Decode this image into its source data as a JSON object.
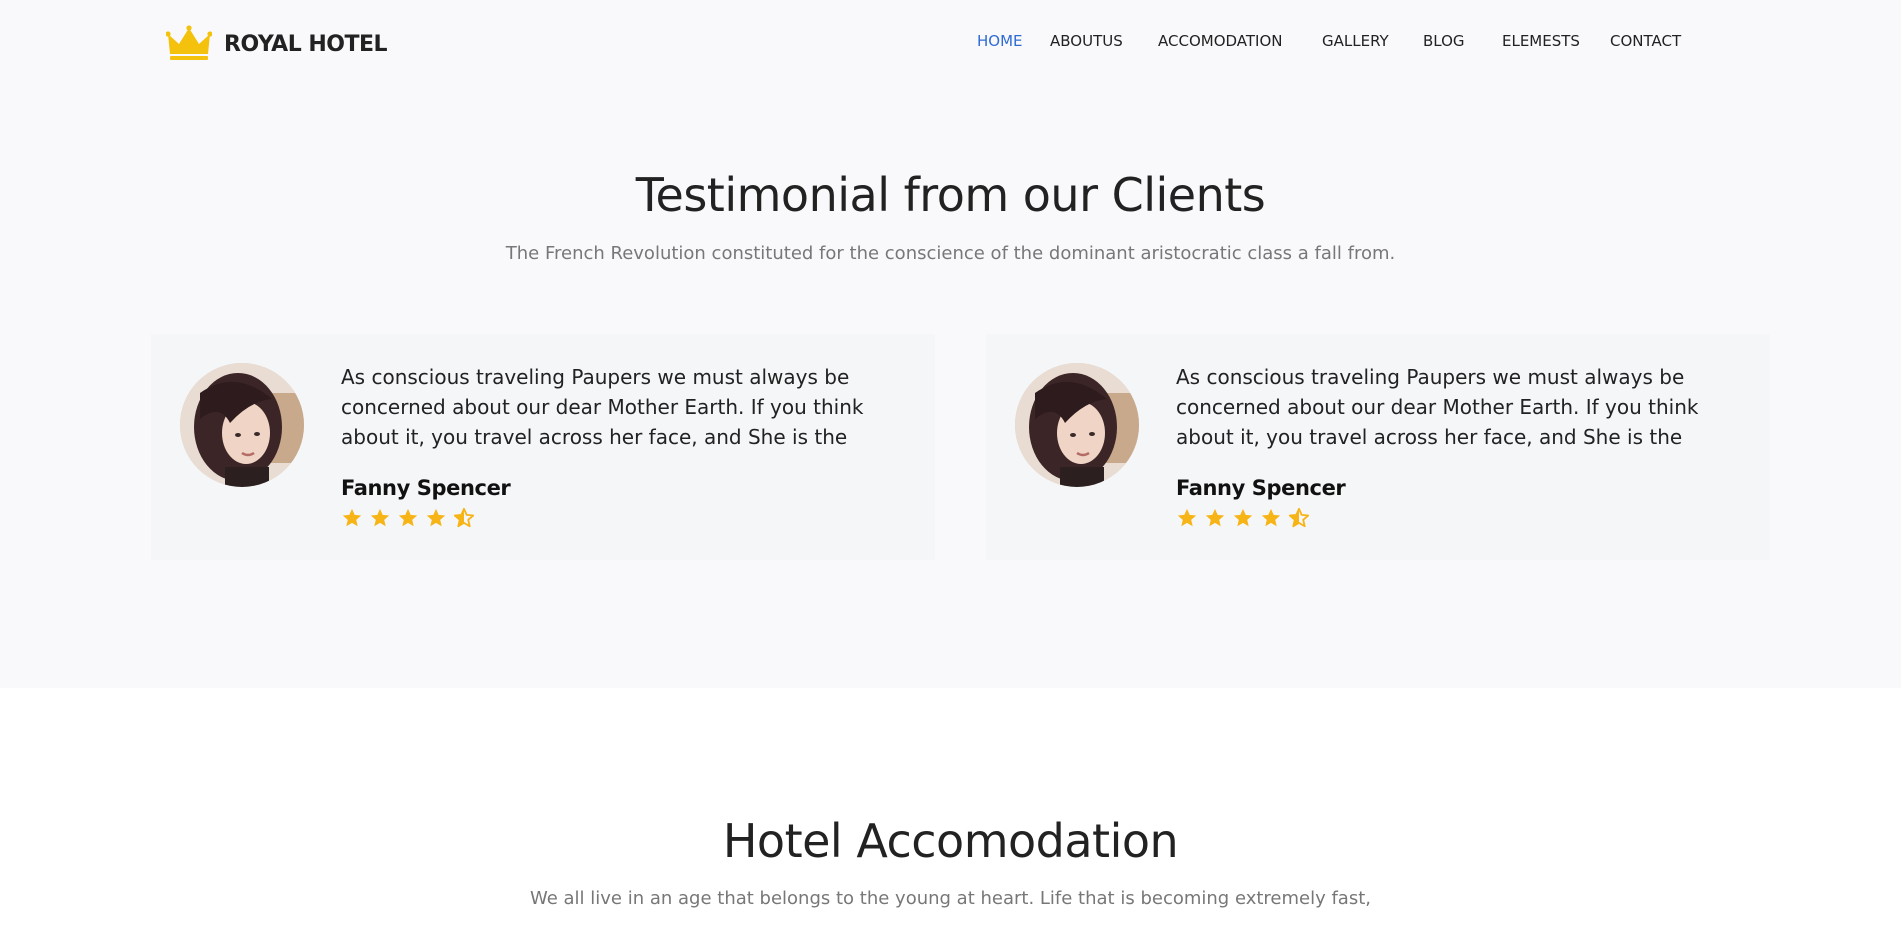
{
  "header": {
    "logo_text": "ROYAL HOTEL",
    "logo_icon": "crown-icon",
    "nav": [
      {
        "label": "HOME",
        "active": true
      },
      {
        "label": "ABOUTUS",
        "active": false
      },
      {
        "label": "ACCOMODATION",
        "active": false
      },
      {
        "label": "GALLERY",
        "active": false
      },
      {
        "label": "BLOG",
        "active": false
      },
      {
        "label": "ELEMESTS",
        "active": false
      },
      {
        "label": "CONTACT",
        "active": false
      }
    ]
  },
  "testimonials": {
    "title": "Testimonial from our Clients",
    "subtitle": "The French Revolution constituted for the conscience of the dominant aristocratic class a fall from.",
    "items": [
      {
        "quote": "As conscious traveling Paupers we must always be concerned about our dear Mother Earth. If you think about it, you travel across her face, and She is the",
        "name": "Fanny Spencer",
        "rating": 4.5
      },
      {
        "quote": "As conscious traveling Paupers we must always be concerned about our dear Mother Earth. If you think about it, you travel across her face, and She is the",
        "name": "Fanny Spencer",
        "rating": 4.5
      }
    ]
  },
  "accomodation": {
    "title": "Hotel Accomodation",
    "subtitle": "We all live in an age that belongs to the young at heart. Life that is becoming extremely fast,"
  },
  "colors": {
    "accent": "#2e6bd3",
    "star": "#f7b416",
    "crown": "#f4c20d"
  }
}
